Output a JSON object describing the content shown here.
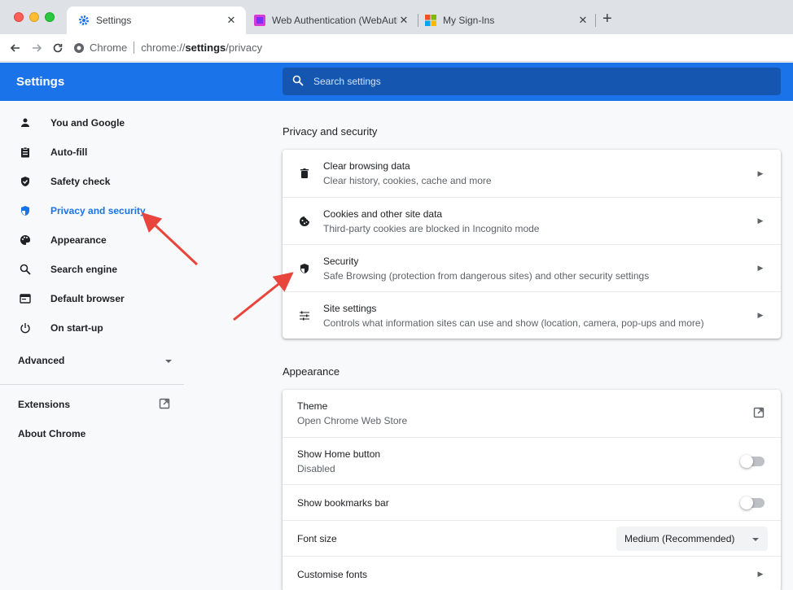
{
  "browser": {
    "tabs": [
      {
        "label": "Settings",
        "close": "✕",
        "icon": "gear-icon"
      },
      {
        "label": "Web Authentication (WebAuthn",
        "close": "✕",
        "icon": "webauthn-favicon"
      },
      {
        "label": "My Sign-Ins",
        "close": "✕",
        "icon": "microsoft-logo-icon"
      }
    ],
    "new_tab": "+",
    "omnibox": {
      "site_label": "Chrome",
      "url_prefix": "chrome://",
      "url_bold": "settings",
      "url_suffix": "/privacy"
    }
  },
  "header": {
    "title": "Settings",
    "search_placeholder": "Search settings"
  },
  "sidebar": {
    "items": [
      {
        "label": "You and Google",
        "icon": "person-icon"
      },
      {
        "label": "Auto-fill",
        "icon": "clipboard-icon"
      },
      {
        "label": "Safety check",
        "icon": "shield-check-icon"
      },
      {
        "label": "Privacy and security",
        "icon": "shield-icon",
        "active": true
      },
      {
        "label": "Appearance",
        "icon": "palette-icon"
      },
      {
        "label": "Search engine",
        "icon": "search-icon"
      },
      {
        "label": "Default browser",
        "icon": "browser-icon"
      },
      {
        "label": "On start-up",
        "icon": "power-icon"
      }
    ],
    "advanced": "Advanced",
    "extensions": "Extensions",
    "about": "About Chrome"
  },
  "privacy": {
    "title": "Privacy and security",
    "rows": [
      {
        "title": "Clear browsing data",
        "subtitle": "Clear history, cookies, cache and more",
        "icon": "trash-icon"
      },
      {
        "title": "Cookies and other site data",
        "subtitle": "Third-party cookies are blocked in Incognito mode",
        "icon": "cookie-icon"
      },
      {
        "title": "Security",
        "subtitle": "Safe Browsing (protection from dangerous sites) and other security settings",
        "icon": "security-shield-icon"
      },
      {
        "title": "Site settings",
        "subtitle": "Controls what information sites can use and show (location, camera, pop-ups and more)",
        "icon": "sliders-icon"
      }
    ]
  },
  "appearance": {
    "title": "Appearance",
    "theme": {
      "title": "Theme",
      "subtitle": "Open Chrome Web Store"
    },
    "home_button": {
      "title": "Show Home button",
      "subtitle": "Disabled",
      "enabled": false
    },
    "bookmarks_bar": {
      "title": "Show bookmarks bar",
      "enabled": false
    },
    "font_size": {
      "title": "Font size",
      "value": "Medium (Recommended)"
    },
    "customise_fonts": {
      "title": "Customise fonts"
    }
  },
  "colors": {
    "accent": "#1a73e8",
    "annotation": "#e8453c"
  }
}
